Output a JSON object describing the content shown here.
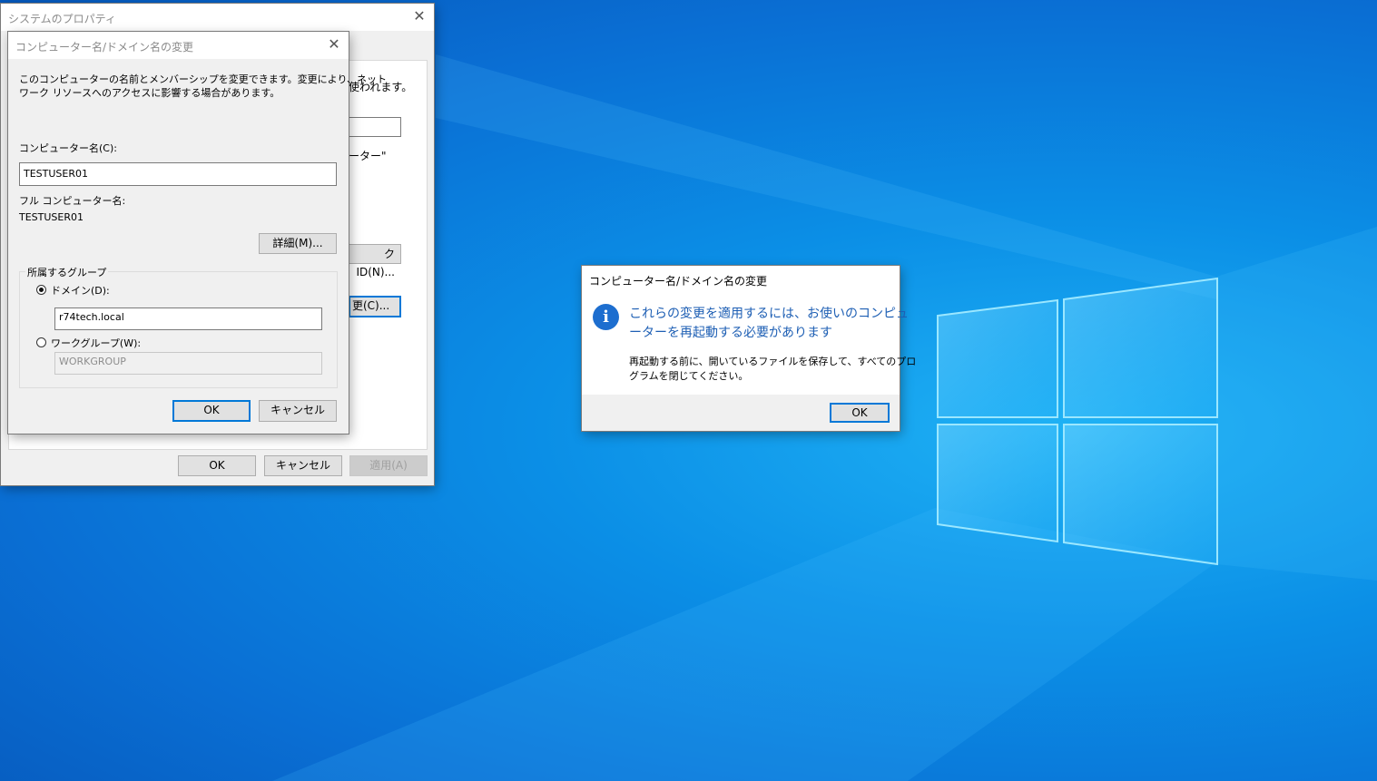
{
  "sys_props": {
    "title": "システムのプロパティ",
    "partial_desc": "使われます。",
    "partial_label": "ーター\"",
    "partial_network_btn": "ク ID(N)...",
    "partial_change_btn": "更(C)...",
    "ok": "OK",
    "cancel": "キャンセル",
    "apply": "適用(A)"
  },
  "rename_dialog": {
    "title": "コンピューター名/ドメイン名の変更",
    "desc_line1": "このコンピューターの名前とメンバーシップを変更できます。変更により、ネット",
    "desc_line2": "ワーク リソースへのアクセスに影響する場合があります。",
    "computer_name_label": "コンピューター名(C):",
    "computer_name_value": "TESTUSER01",
    "full_name_label": "フル コンピューター名:",
    "full_name_value": "TESTUSER01",
    "details_btn": "詳細(M)...",
    "group_legend": "所属するグループ",
    "domain_label": "ドメイン(D):",
    "domain_value": "r74tech.local",
    "workgroup_label": "ワークグループ(W):",
    "workgroup_value": "WORKGROUP",
    "ok": "OK",
    "cancel": "キャンセル"
  },
  "message_box": {
    "title": "コンピューター名/ドメイン名の変更",
    "icon": "info-icon",
    "main_line1": "これらの変更を適用するには、お使いのコンピュ",
    "main_line2": "ーターを再起動する必要があります",
    "sub_line1": "再起動する前に、開いているファイルを保存して、すべてのプロ",
    "sub_line2": "グラムを閉じてください。",
    "ok": "OK"
  },
  "colors": {
    "accent": "#0078d7",
    "message_text": "#1e5fb4",
    "desktop": "#0a78d8"
  }
}
